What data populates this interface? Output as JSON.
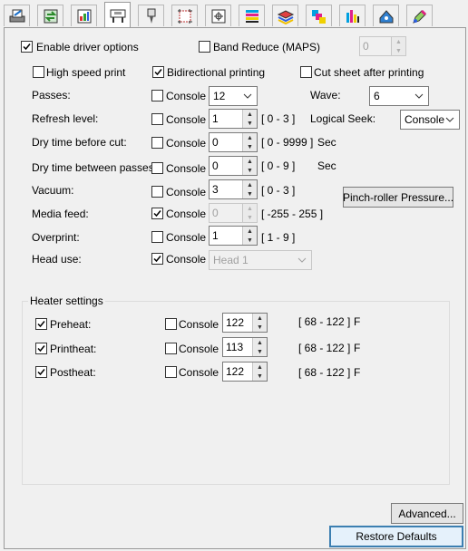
{
  "tabs": [
    {
      "icon": "printer-settings-icon"
    },
    {
      "icon": "media-transfer-icon"
    },
    {
      "icon": "color-image-icon"
    },
    {
      "icon": "plotter-icon"
    },
    {
      "icon": "cutter-tool-icon"
    },
    {
      "icon": "crop-marks-icon"
    },
    {
      "icon": "registration-target-icon"
    },
    {
      "icon": "color-bars-icon"
    },
    {
      "icon": "stacked-media-icon"
    },
    {
      "icon": "color-separation-icon"
    },
    {
      "icon": "ink-levels-icon"
    },
    {
      "icon": "color-shape-icon"
    },
    {
      "icon": "color-picker-icon"
    }
  ],
  "top": {
    "enable_driver_options": {
      "label": "Enable driver options",
      "checked": true
    },
    "band_reduce": {
      "label": "Band Reduce (MAPS)",
      "checked": false,
      "value": "0"
    },
    "high_speed_print": {
      "label": "High speed print",
      "checked": false
    },
    "bidirectional_printing": {
      "label": "Bidirectional printing",
      "checked": true
    },
    "cut_sheet_after_printing": {
      "label": "Cut sheet after printing",
      "checked": false
    }
  },
  "console_label": "Console",
  "rows": {
    "passes": {
      "label": "Passes:",
      "console": false,
      "value": "12"
    },
    "wave": {
      "label": "Wave:",
      "value": "6"
    },
    "refresh_level": {
      "label": "Refresh level:",
      "console": false,
      "value": "1",
      "range": "[ 0 - 3 ]"
    },
    "logical_seek": {
      "label": "Logical Seek:",
      "value": "Console"
    },
    "dry_time_before_cut": {
      "label": "Dry time before cut:",
      "console": false,
      "value": "0",
      "range": "[ 0 - 9999 ]",
      "unit": "Sec"
    },
    "dry_time_between_passes": {
      "label": "Dry time between passes:",
      "console": false,
      "value": "0",
      "range": "[ 0 - 9 ]",
      "unit": "Sec"
    },
    "vacuum": {
      "label": "Vacuum:",
      "console": false,
      "value": "3",
      "range": "[ 0 - 3 ]"
    },
    "media_feed": {
      "label": "Media feed:",
      "console": true,
      "value": "0",
      "range": "[ -255 - 255 ]"
    },
    "overprint": {
      "label": "Overprint:",
      "console": false,
      "value": "1",
      "range": "[ 1 - 9 ]"
    },
    "head_use": {
      "label": "Head use:",
      "console": true,
      "value": "Head 1"
    }
  },
  "pinch_roller_button": "Pinch-roller Pressure...",
  "heater": {
    "title": "Heater settings",
    "preheat": {
      "label": "Preheat:",
      "checked": true,
      "console": false,
      "value": "122",
      "range": "[ 68 - 122 ]",
      "unit": "F"
    },
    "printheat": {
      "label": "Printheat:",
      "checked": true,
      "console": false,
      "value": "113",
      "range": "[ 68 - 122 ]",
      "unit": "F"
    },
    "postheat": {
      "label": "Postheat:",
      "checked": true,
      "console": false,
      "value": "122",
      "range": "[ 68 - 122 ]",
      "unit": "F"
    }
  },
  "advanced_button": "Advanced...",
  "restore_defaults_button": "Restore Defaults",
  "colors": {
    "accent_border": "#3c7fb1",
    "panel_bg": "#f0f0f0"
  }
}
